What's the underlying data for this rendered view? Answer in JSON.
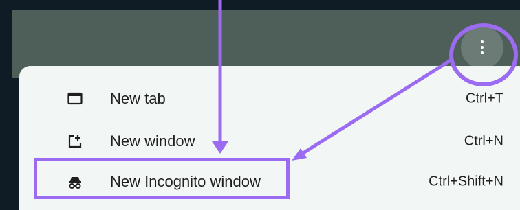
{
  "colors": {
    "page_background": "#0f1c26",
    "toolbar": "#4d5f58",
    "menu_background": "#f2f6f4",
    "annotation": "#9b6bf2"
  },
  "toolbar": {
    "menu_button_icon": "three-dot-vertical-icon"
  },
  "menu": {
    "items": [
      {
        "label": "New tab",
        "shortcut": "Ctrl+T",
        "icon": "tab-icon"
      },
      {
        "label": "New window",
        "shortcut": "Ctrl+N",
        "icon": "new-window-icon"
      },
      {
        "label": "New Incognito window",
        "shortcut": "Ctrl+Shift+N",
        "icon": "incognito-icon"
      }
    ]
  }
}
